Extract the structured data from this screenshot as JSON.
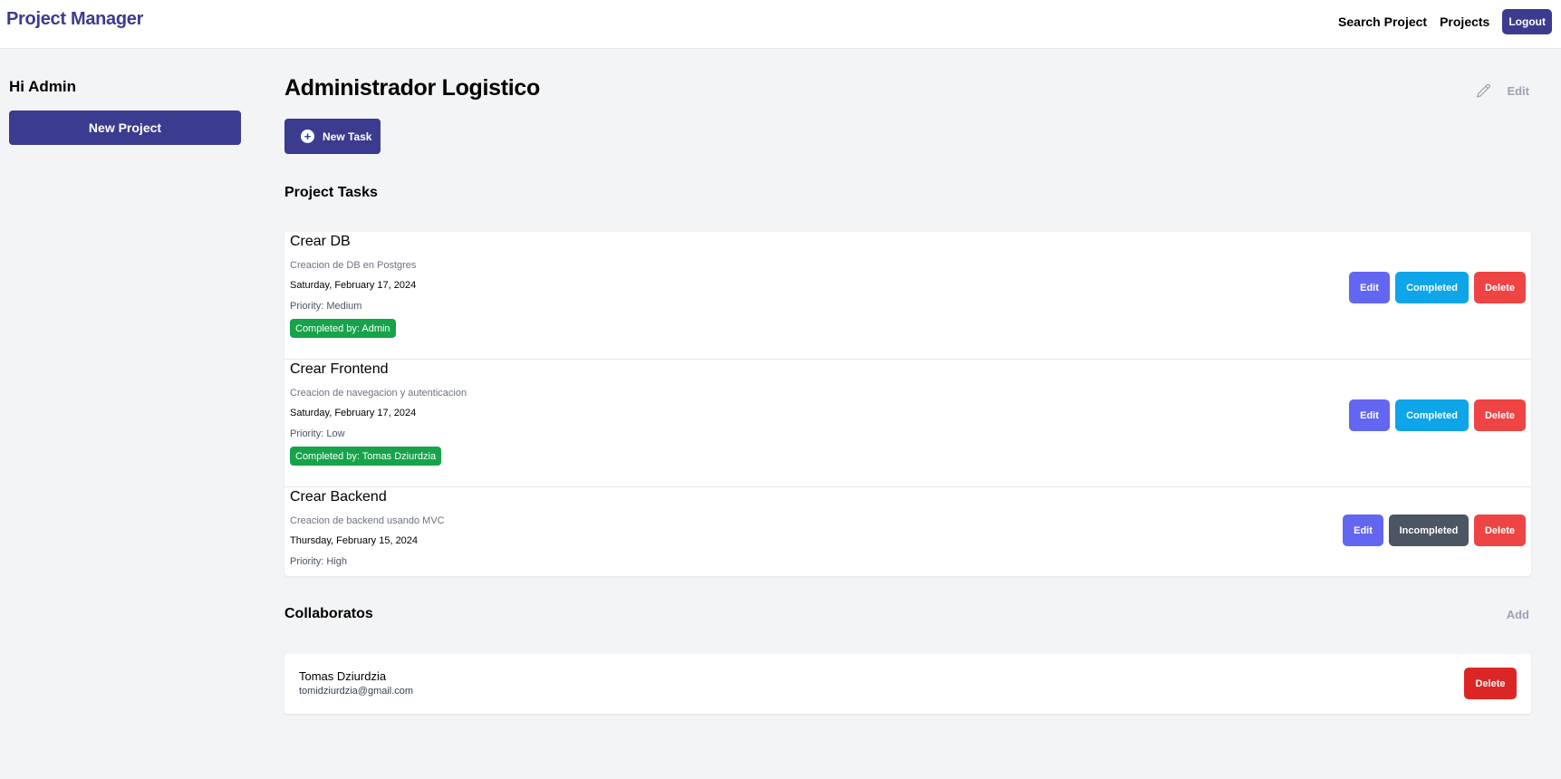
{
  "header": {
    "brand": "Project Manager",
    "nav": [
      "Search Project",
      "Projects"
    ],
    "logout_label": "Logout"
  },
  "sidebar": {
    "greeting": "Hi Admin",
    "new_project_label": "New Project"
  },
  "project": {
    "title": "Administrador Logistico",
    "edit_label": "Edit",
    "new_task_label": "New Task",
    "tasks_heading": "Project Tasks"
  },
  "tasks": [
    {
      "name": "Crear DB",
      "description": "Creacion de DB en Postgres",
      "date": "Saturday, February 17, 2024",
      "priority": "Priority: Medium",
      "completed_by": "Completed by: Admin",
      "edit_label": "Edit",
      "status_label": "Completed",
      "delete_label": "Delete"
    },
    {
      "name": "Crear Frontend",
      "description": "Creacion de navegacion y autenticacion",
      "date": "Saturday, February 17, 2024",
      "priority": "Priority: Low",
      "completed_by": "Completed by: Tomas Dziurdzia",
      "edit_label": "Edit",
      "status_label": "Completed",
      "delete_label": "Delete"
    },
    {
      "name": "Crear Backend",
      "description": "Creacion de backend usando MVC",
      "date": "Thursday, February 15, 2024",
      "priority": "Priority: High",
      "edit_label": "Edit",
      "status_label": "Incompleted",
      "delete_label": "Delete"
    }
  ],
  "collaborators": {
    "heading": "Collaboratos",
    "add_label": "Add",
    "items": [
      {
        "name": "Tomas Dziurdzia",
        "email": "tomidziurdzia@gmail.com",
        "delete_label": "Delete"
      }
    ]
  },
  "icons": {
    "edit": "pencil-icon",
    "new_task": "plus-circle-icon"
  },
  "colors": {
    "brand": "#3b3b8f",
    "edit": "#6366f1",
    "completed": "#0ea5e9",
    "incompleted": "#4b5563",
    "delete": "#ef4444",
    "badge": "#16a34a"
  }
}
